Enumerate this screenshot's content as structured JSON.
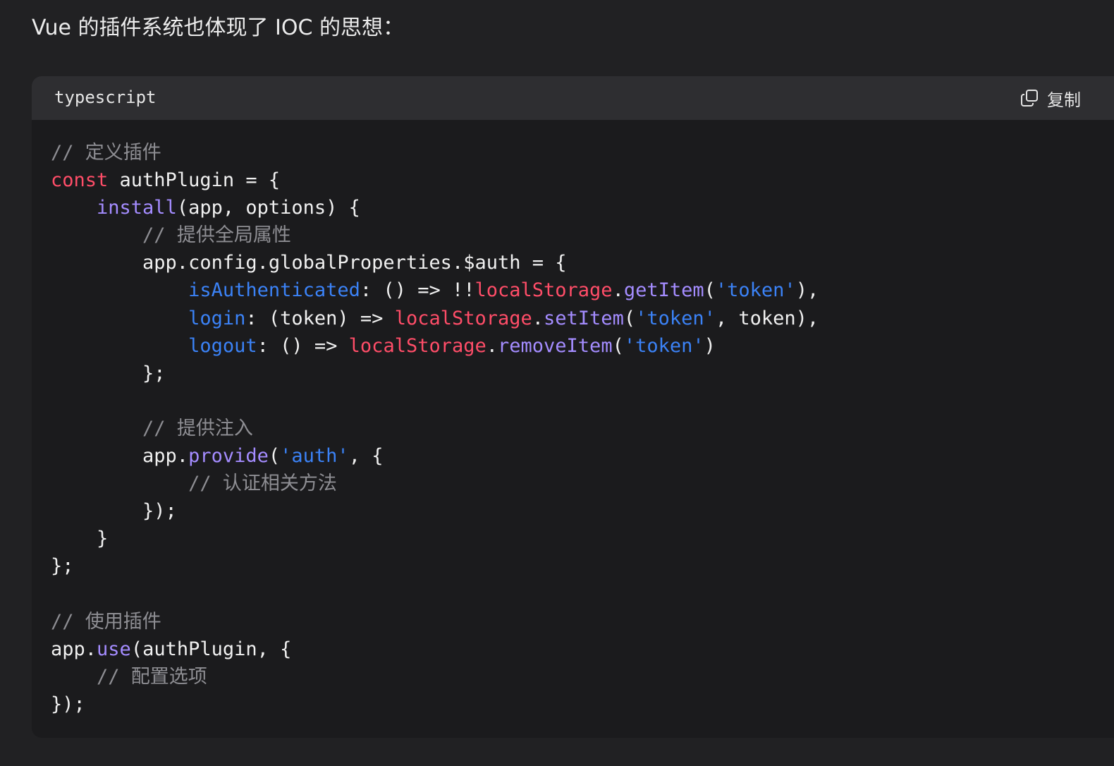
{
  "intro_text": "Vue 的插件系统也体现了 IOC 的思想：",
  "code_block": {
    "language": "typescript",
    "copy_label": "复制",
    "copy_icon": "copy-icon",
    "colors": {
      "background": "#1b1b1d",
      "header": "#2e2e31",
      "keyword": "#ff4d68",
      "function": "#a48cff",
      "property": "#3b82f6",
      "string": "#3b82f6",
      "comment": "#8e8e93"
    },
    "lines": [
      [
        {
          "t": "cm",
          "v": "// 定义插件"
        }
      ],
      [
        {
          "t": "kw",
          "v": "const"
        },
        {
          "t": "plain",
          "v": " authPlugin = {"
        }
      ],
      [
        {
          "t": "plain",
          "v": "    "
        },
        {
          "t": "fn",
          "v": "install"
        },
        {
          "t": "plain",
          "v": "(app, options) {"
        }
      ],
      [
        {
          "t": "plain",
          "v": "        "
        },
        {
          "t": "cm",
          "v": "// 提供全局属性"
        }
      ],
      [
        {
          "t": "plain",
          "v": "        app.config.globalProperties.$auth = {"
        }
      ],
      [
        {
          "t": "plain",
          "v": "            "
        },
        {
          "t": "prop",
          "v": "isAuthenticated"
        },
        {
          "t": "plain",
          "v": ": () => !!"
        },
        {
          "t": "id",
          "v": "localStorage"
        },
        {
          "t": "plain",
          "v": "."
        },
        {
          "t": "fn",
          "v": "getItem"
        },
        {
          "t": "plain",
          "v": "("
        },
        {
          "t": "str",
          "v": "'token'"
        },
        {
          "t": "plain",
          "v": "),"
        }
      ],
      [
        {
          "t": "plain",
          "v": "            "
        },
        {
          "t": "prop",
          "v": "login"
        },
        {
          "t": "plain",
          "v": ": (token) => "
        },
        {
          "t": "id",
          "v": "localStorage"
        },
        {
          "t": "plain",
          "v": "."
        },
        {
          "t": "fn",
          "v": "setItem"
        },
        {
          "t": "plain",
          "v": "("
        },
        {
          "t": "str",
          "v": "'token'"
        },
        {
          "t": "plain",
          "v": ", token),"
        }
      ],
      [
        {
          "t": "plain",
          "v": "            "
        },
        {
          "t": "prop",
          "v": "logout"
        },
        {
          "t": "plain",
          "v": ": () => "
        },
        {
          "t": "id",
          "v": "localStorage"
        },
        {
          "t": "plain",
          "v": "."
        },
        {
          "t": "fn",
          "v": "removeItem"
        },
        {
          "t": "plain",
          "v": "("
        },
        {
          "t": "str",
          "v": "'token'"
        },
        {
          "t": "plain",
          "v": ")"
        }
      ],
      [
        {
          "t": "plain",
          "v": "        };"
        }
      ],
      [],
      [
        {
          "t": "plain",
          "v": "        "
        },
        {
          "t": "cm",
          "v": "// 提供注入"
        }
      ],
      [
        {
          "t": "plain",
          "v": "        app."
        },
        {
          "t": "fn",
          "v": "provide"
        },
        {
          "t": "plain",
          "v": "("
        },
        {
          "t": "str",
          "v": "'auth'"
        },
        {
          "t": "plain",
          "v": ", {"
        }
      ],
      [
        {
          "t": "plain",
          "v": "            "
        },
        {
          "t": "cm",
          "v": "// 认证相关方法"
        }
      ],
      [
        {
          "t": "plain",
          "v": "        });"
        }
      ],
      [
        {
          "t": "plain",
          "v": "    }"
        }
      ],
      [
        {
          "t": "plain",
          "v": "};"
        }
      ],
      [],
      [
        {
          "t": "cm",
          "v": "// 使用插件"
        }
      ],
      [
        {
          "t": "plain",
          "v": "app."
        },
        {
          "t": "fn",
          "v": "use"
        },
        {
          "t": "plain",
          "v": "(authPlugin, {"
        }
      ],
      [
        {
          "t": "plain",
          "v": "    "
        },
        {
          "t": "cm",
          "v": "// 配置选项"
        }
      ],
      [
        {
          "t": "plain",
          "v": "});"
        }
      ]
    ]
  }
}
